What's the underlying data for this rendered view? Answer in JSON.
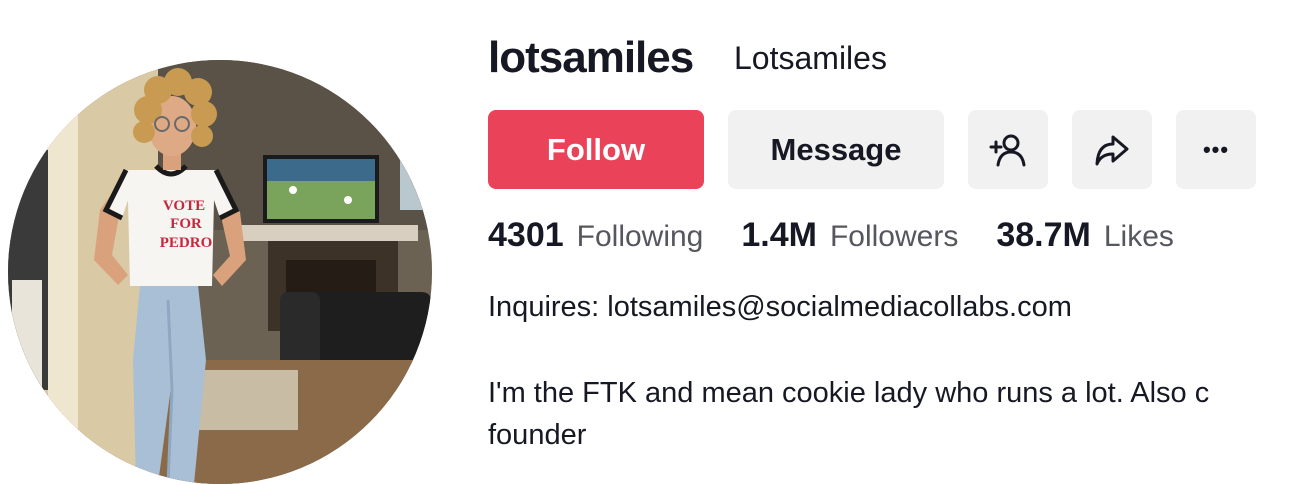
{
  "profile": {
    "username": "lotsamiles",
    "nickname": "Lotsamiles",
    "avatar_icon": "profile-photo",
    "shirt_text": [
      "VOTE",
      "FOR",
      "PEDRO"
    ]
  },
  "actions": {
    "follow_label": "Follow",
    "message_label": "Message",
    "add_friend_icon": "add-user-icon",
    "share_icon": "share-icon",
    "more_icon": "more-icon",
    "more_glyph": "•••"
  },
  "stats": {
    "following": {
      "count": "4301",
      "label": "Following"
    },
    "followers": {
      "count": "1.4M",
      "label": "Followers"
    },
    "likes": {
      "count": "38.7M",
      "label": "Likes"
    }
  },
  "bio": {
    "contact": "Inquires: lotsamiles@socialmediacollabs.com",
    "line1": "I'm the FTK and mean cookie lady who runs a lot. Also c",
    "line2": "founder"
  },
  "colors": {
    "follow_bg": "#ea4359",
    "secondary_bg": "#f1f1f2",
    "text_primary": "#161823",
    "text_secondary": "#55565e"
  }
}
